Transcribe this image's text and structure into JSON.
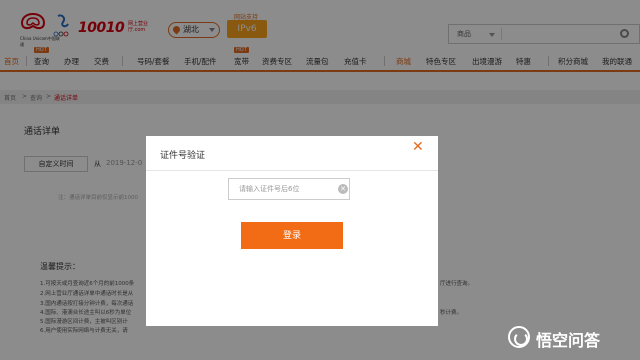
{
  "header": {
    "logo_text": "China Unicom中国联通",
    "brand": "10010",
    "brand_sub": "网上营业厅.com",
    "region": "湖北",
    "ipv6_label": "网站支持",
    "ipv6": "IPv6",
    "search_category": "商品"
  },
  "nav": {
    "items": [
      {
        "label": "首页"
      },
      {
        "label": "查询"
      },
      {
        "label": "办理"
      },
      {
        "label": "交费"
      },
      {
        "label": "号码/套餐"
      },
      {
        "label": "手机/配件"
      },
      {
        "label": "宽带"
      },
      {
        "label": "资费专区"
      },
      {
        "label": "流量包"
      },
      {
        "label": "充值卡"
      },
      {
        "label": "商城"
      },
      {
        "label": "特色专区"
      },
      {
        "label": "出境漫游"
      },
      {
        "label": "特惠"
      },
      {
        "label": "积分商城"
      },
      {
        "label": "我的联通"
      }
    ]
  },
  "breadcrumb": {
    "home": "首页",
    "sep1": ">",
    "query": "查询",
    "sep2": ">",
    "current": "通话详单"
  },
  "page": {
    "title": "通话详单",
    "custom_time": "自定义时间",
    "from": "从",
    "date": "2019-12-0",
    "note": "注：通话详单目前仅显示前1000",
    "tips_title": "温馨提示：",
    "tips": [
      "1.可按天或月查询近6个月的前1000条",
      "2.网上营业厅通话详单中通话时长是从",
      "3.国内通话按打接分钟计费，每次通话",
      "4.国际、港澳台长途主叫以6秒为单位",
      "5.国际漫游区间计费，主被叫区别计",
      "6.用户使用实际网络与计费无关，请"
    ],
    "tips_right": [
      "厅进行查询。",
      "",
      "",
      "秒计费。",
      "",
      ""
    ]
  },
  "modal": {
    "title": "证件号验证",
    "close": "✕",
    "input_placeholder": "请输入证件号后6位",
    "clear": "✕",
    "login": "登录"
  },
  "watermark": {
    "text": "悟空问答"
  },
  "colors": {
    "accent": "#e06b1f",
    "brand_red": "#d6000f",
    "button": "#f26c16"
  }
}
